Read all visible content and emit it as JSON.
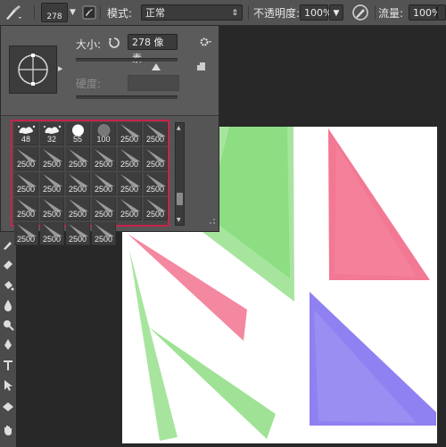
{
  "options_bar": {
    "brush_size": "278",
    "mode_label": "模式:",
    "mode_value": "正常",
    "opacity_label": "不透明度:",
    "opacity_value": "100%",
    "flow_label": "流量:",
    "flow_value": "100%"
  },
  "brush_panel": {
    "size_label": "大小:",
    "size_value": "278 像素",
    "hardness_label": "硬度:",
    "presets": [
      {
        "label": "48",
        "shape": "splatter"
      },
      {
        "label": "32",
        "shape": "splatter"
      },
      {
        "label": "55",
        "shape": "round-hard"
      },
      {
        "label": "100",
        "shape": "round-texture"
      },
      {
        "label": "2500",
        "shape": "ray"
      },
      {
        "label": "2500",
        "shape": "ray"
      },
      {
        "label": "2500",
        "shape": "ray"
      },
      {
        "label": "2500",
        "shape": "ray"
      },
      {
        "label": "2500",
        "shape": "ray"
      },
      {
        "label": "2500",
        "shape": "ray"
      },
      {
        "label": "2500",
        "shape": "ray"
      },
      {
        "label": "2500",
        "shape": "ray"
      },
      {
        "label": "2500",
        "shape": "ray"
      },
      {
        "label": "2500",
        "shape": "ray"
      },
      {
        "label": "2500",
        "shape": "ray"
      },
      {
        "label": "2500",
        "shape": "ray"
      },
      {
        "label": "2500",
        "shape": "ray"
      },
      {
        "label": "2500",
        "shape": "ray"
      },
      {
        "label": "2500",
        "shape": "ray"
      },
      {
        "label": "2500",
        "shape": "ray"
      },
      {
        "label": "2500",
        "shape": "ray"
      },
      {
        "label": "2500",
        "shape": "ray"
      },
      {
        "label": "2500",
        "shape": "ray"
      },
      {
        "label": "2500",
        "shape": "ray"
      },
      {
        "label": "2500",
        "shape": "ray"
      },
      {
        "label": "2500",
        "shape": "ray"
      },
      {
        "label": "2500",
        "shape": "ray"
      },
      {
        "label": "2500",
        "shape": "ray"
      }
    ]
  },
  "icons": {
    "brush_tool": "brush-icon",
    "brush_panel_toggle": "brush-panel-icon",
    "reset_size": "reset-icon",
    "settings": "gear-icon",
    "new_preset": "new-preset-icon",
    "airbrush": "airbrush-icon"
  },
  "colors": {
    "selection_outline": "#c8234a",
    "stroke_green": "#5fcf4f",
    "stroke_red": "#f06080",
    "stroke_purple": "#7b6bee"
  }
}
